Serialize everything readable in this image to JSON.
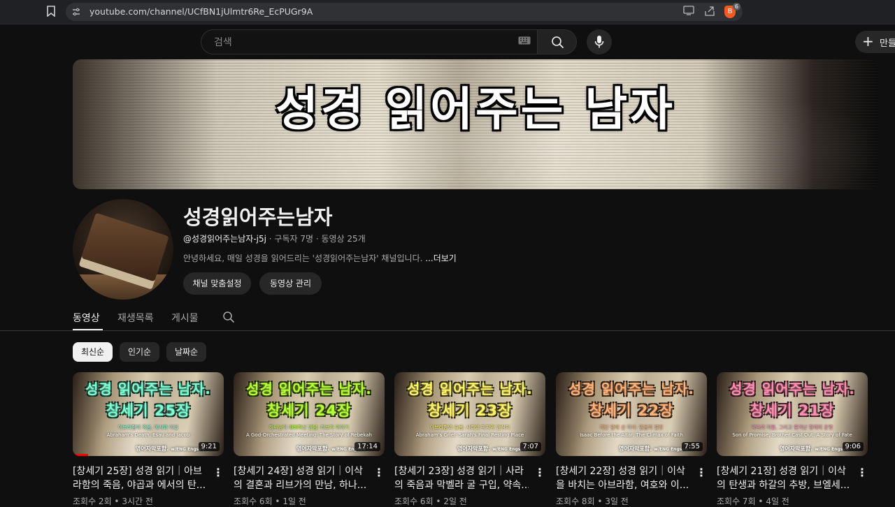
{
  "browser": {
    "url": "youtube.com/channel/UCfBN1jUlmtr6Re_EcPUGr9A",
    "brave_badge": "6"
  },
  "header": {
    "search_placeholder": "검색",
    "create_label": "만들"
  },
  "banner": {
    "title": "성경 읽어주는 남자"
  },
  "channel": {
    "name": "성경읽어주는남자",
    "handle": "@성경읽어주는남자-j5j",
    "stats": " · 구독자 7명 · 동영상 25개",
    "description": "안녕하세요, 매일 성경을 읽어드리는 '성경읽어주는남자' 채널입니다. ",
    "more": "...더보기",
    "customize_label": "채널 맞춤설정",
    "manage_label": "동영상 관리"
  },
  "tabs": [
    "동영상",
    "재생목록",
    "게시물"
  ],
  "chips": [
    "최신순",
    "인기순",
    "날짜순"
  ],
  "colors": {
    "background": "#0f0f0f",
    "progress": "#ff0000"
  },
  "videos": [
    {
      "thumb_title": "성경 읽어주는 남자.",
      "thumb_chapter": "창세기 25장",
      "thumb_sub_ko": "아브라함의 죽음, 에서와 야곱",
      "thumb_sub_en": "Abraham's Death, Esau and Jacob",
      "thumb_tag": "영어자막포함.",
      "thumb_tag_small": "w/ENG Engsub",
      "color": "#7fffd4",
      "duration": "9:21",
      "progress": 0.1,
      "title_line1": "[창세기 25장] 성경 읽기｜아브",
      "title_line2": "라함의 죽음, 야곱과 에서의 탄...",
      "meta": "조회수 2회 • 3시간 전"
    },
    {
      "thumb_title": "성경 읽어주는 남자.",
      "thumb_chapter": "창세기 24장",
      "thumb_sub_ko": "하나님이 예비하신 만남: 리브가 이야기",
      "thumb_sub_en": "A God-Orchestrated Meeting: The Story of Rebekah",
      "thumb_tag": "영어자막포함.",
      "thumb_tag_small": "w/ENG Engsub",
      "color": "#b6ff3a",
      "duration": "17:14",
      "progress": 0,
      "title_line1": "[창세기 24장] 성경 읽기｜이삭",
      "title_line2": "의 결혼과 리브가의 만남, 하나...",
      "meta": "조회수 6회 • 1일 전"
    },
    {
      "thumb_title": "성경 읽어주는 남자.",
      "thumb_chapter": "창세기 23장",
      "thumb_sub_ko": "아브라함의 슬픔: 사라의 마지막 안식처",
      "thumb_sub_en": "Abraham's Grief: Sarah's Final Resting Place",
      "thumb_tag": "영어자막포함.",
      "thumb_tag_small": "w/ENG Engsub",
      "color": "#fff36b",
      "duration": "7:07",
      "progress": 0,
      "title_line1": "[창세기 23장] 성경 읽기｜사라",
      "title_line2": "의 죽음과 막벨라 굴 구입, 약속...",
      "meta": "조회수 6회 • 2일 전"
    },
    {
      "thumb_title": "성경 읽어주는 남자.",
      "thumb_chapter": "창세기 22장",
      "thumb_sub_ko": "제단 앞에 선 이삭: 믿음의 절정",
      "thumb_sub_en": "Isaac Before the Altar: The Climax of Faith",
      "thumb_tag": "영어자막포함.",
      "thumb_tag_small": "w/ENG Engsub",
      "color": "#ffb27a",
      "duration": "7:55",
      "progress": 0,
      "title_line1": "[창세기 22장] 성경 읽기｜이삭",
      "title_line2": "을 바치는 아브라함, 여호와 이...",
      "meta": "조회수 8회 • 3일 전"
    },
    {
      "thumb_title": "성경 읽어주는 남자.",
      "thumb_chapter": "창세기 21장",
      "thumb_sub_ko": "약속의 아들, 그리고 쫓겨난 형제의 운명",
      "thumb_sub_en": "Son of Promise, Brother Cast Out: A Story of Fate",
      "thumb_tag": "영어자막포함.",
      "thumb_tag_small": "w/ENG Engsub",
      "color": "#ff8fb1",
      "duration": "9:06",
      "progress": 0,
      "title_line1": "[창세기 21장] 성경 읽기｜이삭",
      "title_line2": "의 탄생과 하갈의 추방, 브엘세...",
      "meta": "조회수 7회 • 4일 전"
    }
  ]
}
